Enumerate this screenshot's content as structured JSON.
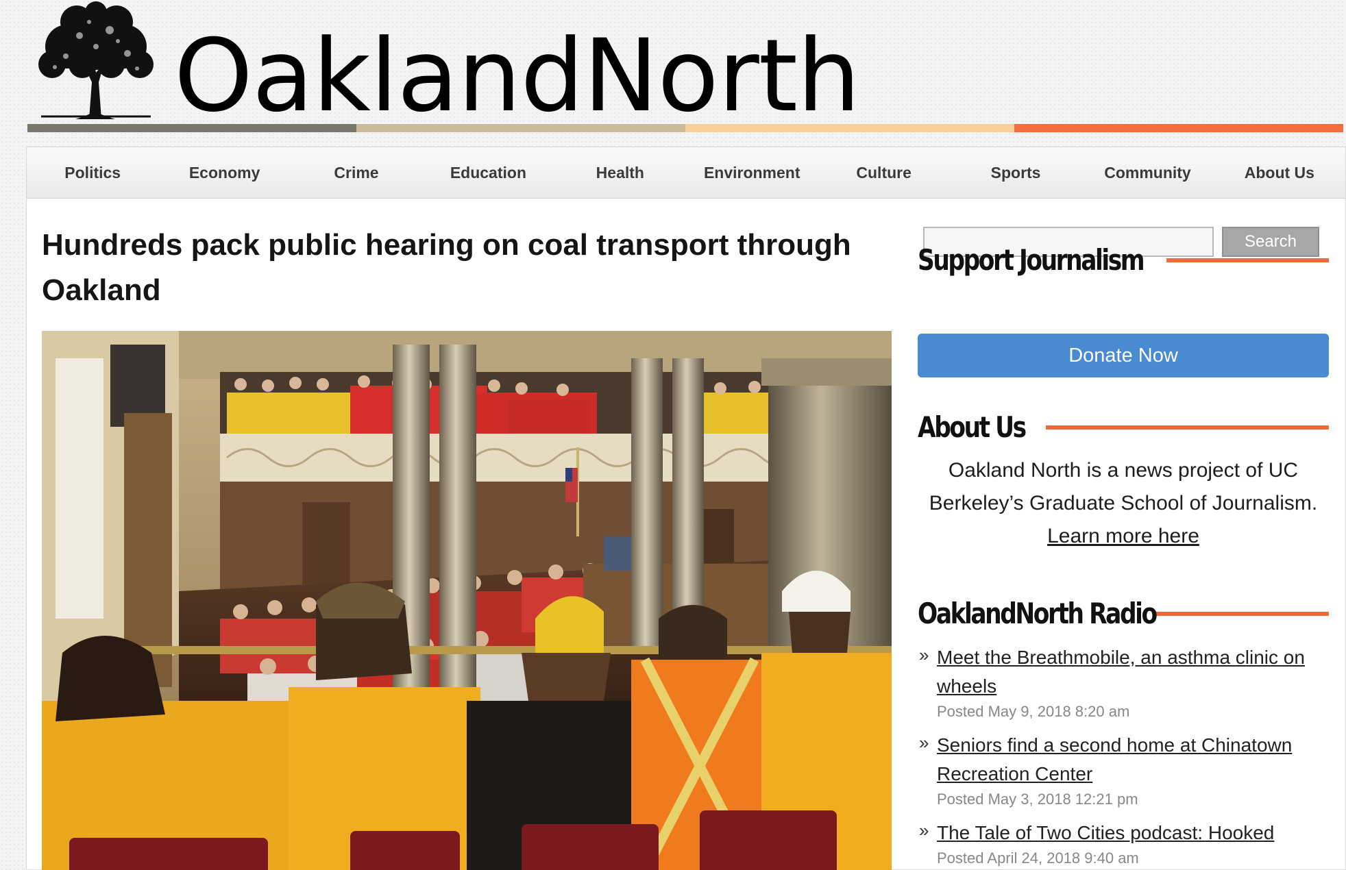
{
  "site": {
    "title": "OaklandNorth"
  },
  "colors": {
    "bar": [
      "#7a786c",
      "#cbbb9a",
      "#f9cf98",
      "#f16e3c"
    ],
    "accent": "#f06c3a",
    "donate": "#4a8ad0"
  },
  "nav": {
    "items": [
      "Politics",
      "Economy",
      "Crime",
      "Education",
      "Health",
      "Environment",
      "Culture",
      "Sports",
      "Community",
      "About Us"
    ]
  },
  "article": {
    "headline": "Hundreds pack public hearing on coal transport through Oakland"
  },
  "search": {
    "placeholder": "",
    "button_label": "Search"
  },
  "support": {
    "heading": "Support Journalism",
    "button_label": "Donate Now"
  },
  "about": {
    "heading": "About Us",
    "text": "Oakland North is a news project of UC Berkeley’s Graduate School of Journalism.",
    "link": "Learn more here"
  },
  "radio": {
    "heading": "OaklandNorth Radio",
    "bullet": "»",
    "items": [
      {
        "title": "Meet the Breathmobile, an asthma clinic on wheels",
        "date": "Posted May 9, 2018 8:20 am"
      },
      {
        "title": "Seniors find a second home at Chinatown Recreation Center",
        "date": "Posted May 3, 2018 12:21 pm"
      },
      {
        "title": "The Tale of Two Cities podcast: Hooked",
        "date": "Posted April 24, 2018 9:40 am"
      }
    ]
  }
}
